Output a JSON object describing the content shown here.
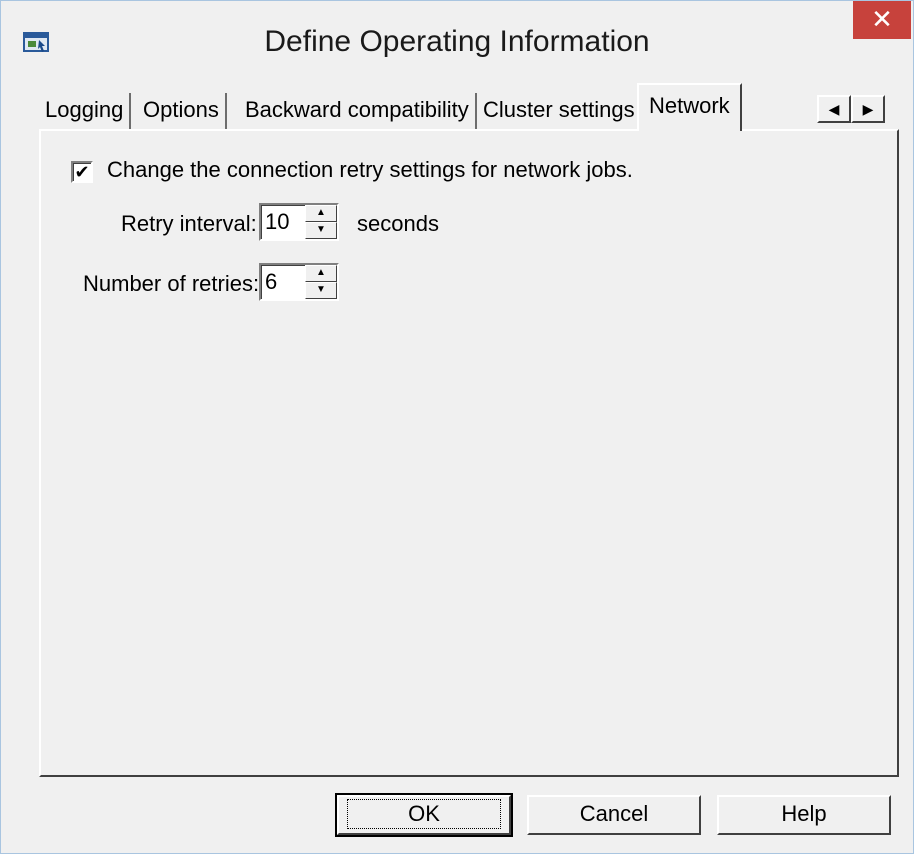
{
  "window": {
    "title": "Define Operating Information",
    "close_glyph": "✕",
    "icon": "app-window-icon"
  },
  "tabs": [
    {
      "label": "Logging",
      "active": false
    },
    {
      "label": "Options",
      "active": false
    },
    {
      "label": "Backward compatibility",
      "active": false
    },
    {
      "label": "Cluster settings",
      "active": false
    },
    {
      "label": "Network",
      "active": true
    }
  ],
  "tab_scroll": {
    "left_glyph": "◀",
    "right_glyph": "▶"
  },
  "network": {
    "checkbox": {
      "label": "Change the connection retry settings for network jobs.",
      "checked": true,
      "glyph": "✔"
    },
    "retry_interval": {
      "label": "Retry interval:",
      "value": "10",
      "unit": "seconds"
    },
    "number_of_retries": {
      "label": "Number of retries:",
      "value": "6"
    },
    "spin_up_glyph": "▲",
    "spin_down_glyph": "▼"
  },
  "buttons": {
    "ok": "OK",
    "cancel": "Cancel",
    "help": "Help"
  },
  "colors": {
    "close_button": "#c7423c",
    "face": "#f0f0f0"
  }
}
